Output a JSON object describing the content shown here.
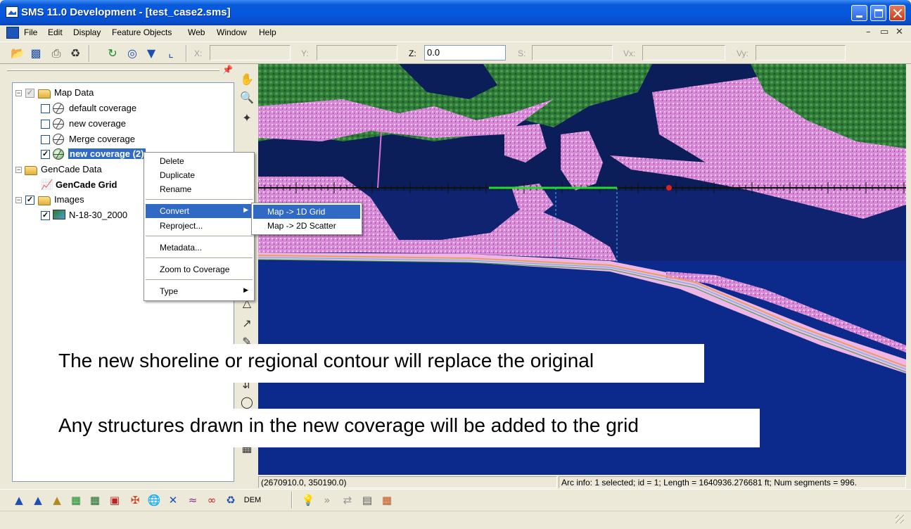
{
  "window": {
    "title": "SMS 11.0 Development - [test_case2.sms]"
  },
  "menubar": {
    "items": [
      "File",
      "Edit",
      "Display",
      "Feature Objects",
      "Web",
      "Window",
      "Help"
    ],
    "mdi_minimize": "–",
    "mdi_restore": "▭",
    "mdi_close": "✕"
  },
  "toolbar": {
    "coords": {
      "x_label": "X:",
      "y_label": "Y:",
      "z_label": "Z:",
      "z_value": "0.0",
      "s_label": "S:",
      "vx_label": "Vx:",
      "vy_label": "Vy:"
    },
    "icons": [
      "open-folder-icon",
      "save-icon",
      "print-icon",
      "delete-icon",
      "refresh-icon",
      "zoom-frame-icon",
      "get-info-icon",
      "axes-icon"
    ]
  },
  "tree": {
    "map_data": "Map Data",
    "default_coverage": "default coverage",
    "new_coverage": "new coverage",
    "merge_coverage": "Merge coverage",
    "new_coverage_selected": "new coverage (2)",
    "gencade_data": "GenCade Data",
    "gencade_grid": "GenCade Grid",
    "images": "Images",
    "image_item": "N-18-30_2000"
  },
  "context_menu": {
    "delete": "Delete",
    "duplicate": "Duplicate",
    "rename": "Rename",
    "convert": "Convert",
    "reproject": "Reproject...",
    "metadata": "Metadata...",
    "zoom_to_coverage": "Zoom to Coverage",
    "type": "Type"
  },
  "submenu": {
    "map_1d_grid": "Map -> 1D Grid",
    "map_2d_scatter": "Map -> 2D Scatter"
  },
  "captions": {
    "line1": "The new shoreline or regional contour will replace the original",
    "line2": "Any structures drawn in the new coverage will be added to the grid"
  },
  "statusbar": {
    "cursor": "(2670910.0, 350190.0)",
    "arc_info": "Arc info: 1 selected; id = 1; Length = 1640936.276681 ft; Num segments = 996."
  },
  "bottombar": {
    "dem_label": "DEM"
  },
  "colors": {
    "title_bar": "#0458e0",
    "selection": "#316ac5",
    "water": "#0e2166",
    "land": "#d88ad8",
    "grid_green": "#22dd22"
  }
}
